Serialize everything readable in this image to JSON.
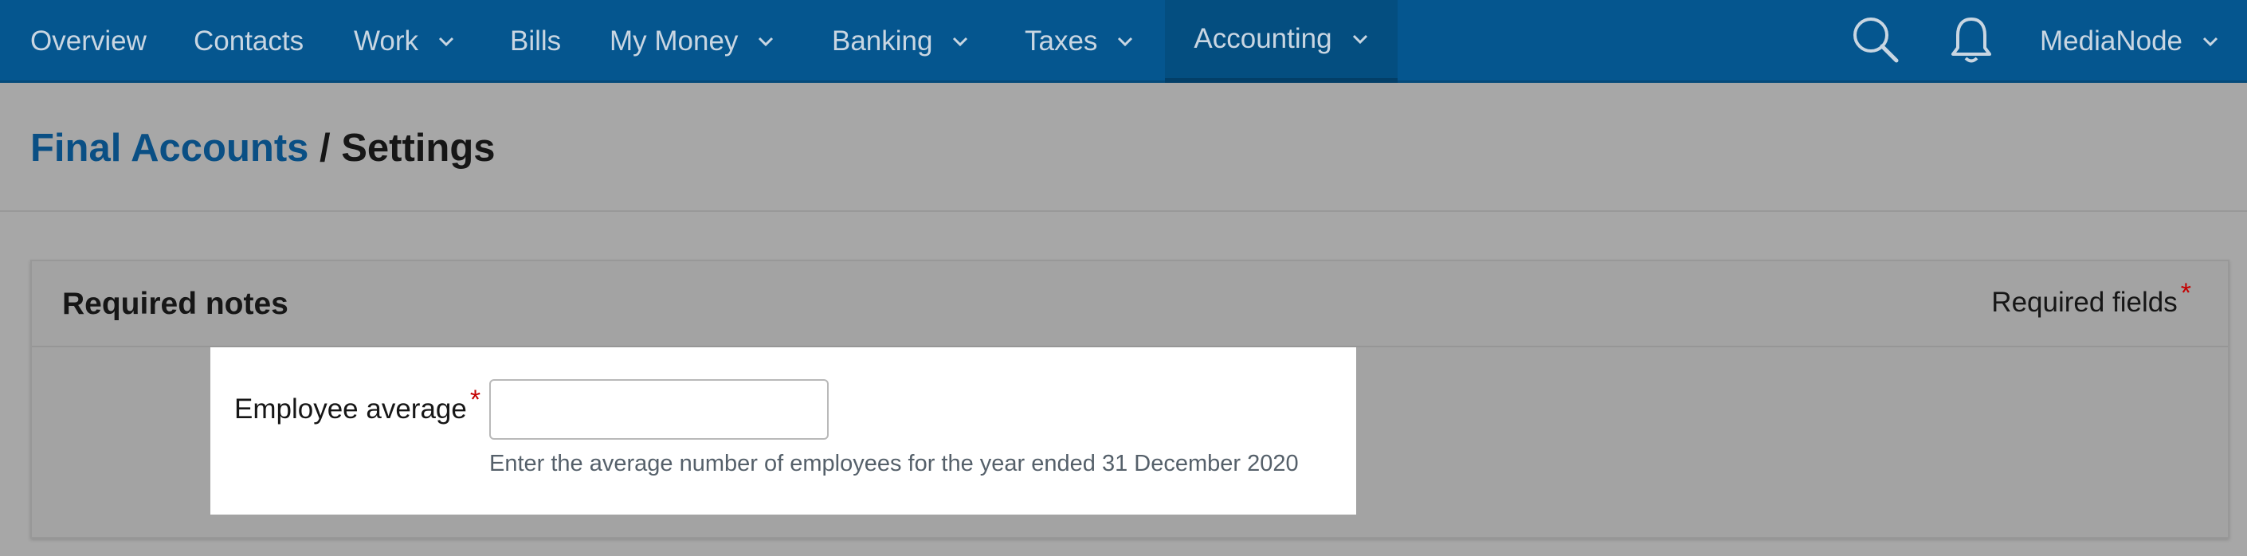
{
  "nav": {
    "items": [
      {
        "label": "Overview"
      },
      {
        "label": "Contacts"
      },
      {
        "label": "Work"
      },
      {
        "label": "Bills"
      },
      {
        "label": "My Money"
      },
      {
        "label": "Banking"
      },
      {
        "label": "Taxes"
      },
      {
        "label": "Accounting"
      }
    ],
    "account_label": "MediaNode"
  },
  "breadcrumb": {
    "parent": "Final Accounts",
    "separator": " / ",
    "current": "Settings"
  },
  "panel": {
    "title": "Required notes",
    "required_fields_label": "Required fields",
    "required_marker": "*"
  },
  "form": {
    "employee_average": {
      "label": "Employee average",
      "value": "",
      "placeholder": "",
      "help": "Enter the average number of employees for the year ended 31 December 2020"
    }
  },
  "colors": {
    "nav_bg": "#05568f",
    "link": "#0a4f84",
    "required_star": "#c40000"
  }
}
